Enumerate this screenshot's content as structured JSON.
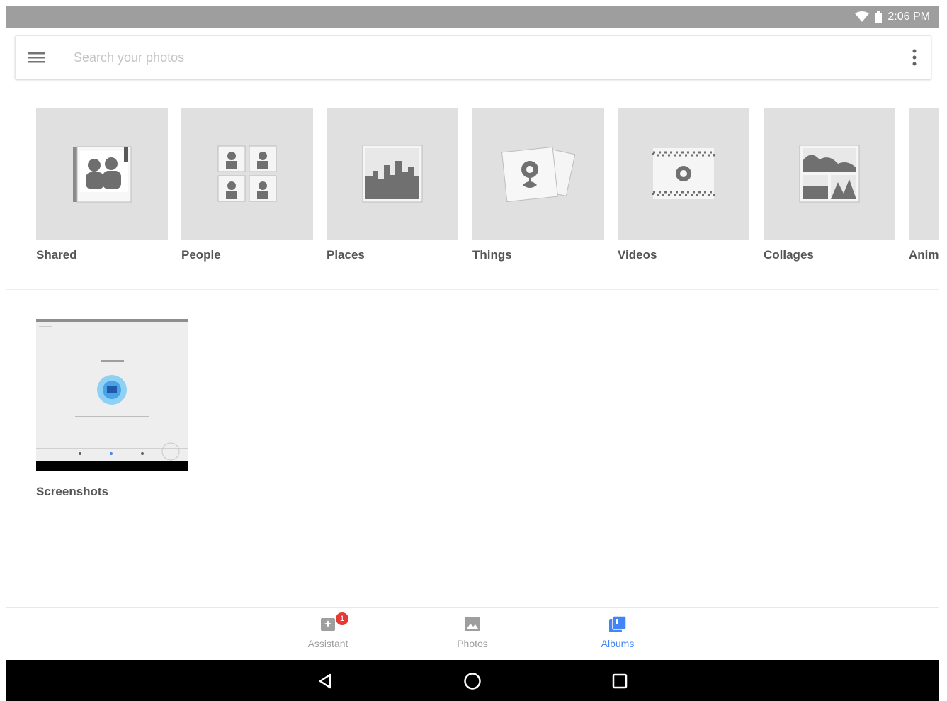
{
  "status_bar": {
    "time": "2:06 PM",
    "wifi_icon": "wifi-icon",
    "battery_icon": "battery-icon"
  },
  "search": {
    "placeholder": "Search your photos"
  },
  "categories": [
    {
      "label": "Shared",
      "icon": "shared-album-icon"
    },
    {
      "label": "People",
      "icon": "people-icon"
    },
    {
      "label": "Places",
      "icon": "places-icon"
    },
    {
      "label": "Things",
      "icon": "things-icon"
    },
    {
      "label": "Videos",
      "icon": "videos-icon"
    },
    {
      "label": "Collages",
      "icon": "collages-icon"
    },
    {
      "label": "Anim",
      "icon": "animations-icon"
    }
  ],
  "albums": [
    {
      "label": "Screenshots"
    }
  ],
  "bottom_nav": {
    "items": [
      {
        "label": "Assistant",
        "badge": "1",
        "icon": "assistant-icon",
        "active": false
      },
      {
        "label": "Photos",
        "icon": "photos-icon",
        "active": false
      },
      {
        "label": "Albums",
        "icon": "albums-icon",
        "active": true
      }
    ],
    "active_color": "#4285f4",
    "inactive_color": "#9e9e9e"
  }
}
